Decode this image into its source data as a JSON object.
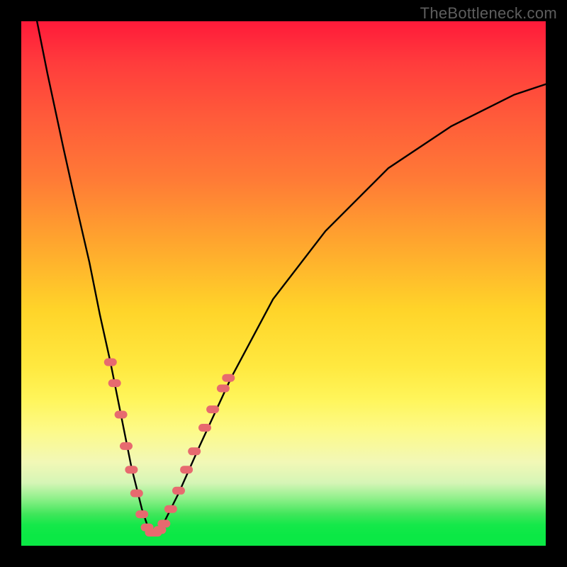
{
  "watermark": "TheBottleneck.com",
  "colors": {
    "background": "#000000",
    "curve": "#000000",
    "marker_fill": "#e76a6f",
    "marker_stroke": "#e76a6f"
  },
  "chart_data": {
    "type": "line",
    "title": "",
    "xlabel": "",
    "ylabel": "",
    "xlim": [
      0,
      100
    ],
    "ylim": [
      0,
      100
    ],
    "note": "Numeric axis values are estimated from pixel positions; no tick labels are visible in the source image.",
    "series": [
      {
        "name": "bottleneck-curve",
        "x": [
          3,
          5,
          8,
          10,
          13,
          15,
          17,
          19,
          21,
          23,
          24.5,
          26,
          27,
          30,
          34,
          40,
          48,
          58,
          70,
          82,
          94,
          100
        ],
        "y": [
          100,
          90,
          76,
          67,
          54,
          44,
          35,
          25,
          15,
          7,
          2.5,
          2.5,
          4,
          10,
          19,
          32,
          47,
          60,
          72,
          80,
          86,
          88
        ]
      }
    ],
    "markers": [
      {
        "x": 17.0,
        "y": 35.0
      },
      {
        "x": 17.8,
        "y": 31.0
      },
      {
        "x": 19.0,
        "y": 25.0
      },
      {
        "x": 20.0,
        "y": 19.0
      },
      {
        "x": 21.0,
        "y": 14.5
      },
      {
        "x": 22.0,
        "y": 10.0
      },
      {
        "x": 23.0,
        "y": 6.0
      },
      {
        "x": 24.0,
        "y": 3.5
      },
      {
        "x": 24.8,
        "y": 2.5
      },
      {
        "x": 25.6,
        "y": 2.5
      },
      {
        "x": 26.4,
        "y": 3.0
      },
      {
        "x": 27.2,
        "y": 4.2
      },
      {
        "x": 28.5,
        "y": 7.0
      },
      {
        "x": 30.0,
        "y": 10.5
      },
      {
        "x": 31.5,
        "y": 14.5
      },
      {
        "x": 33.0,
        "y": 18.0
      },
      {
        "x": 35.0,
        "y": 22.5
      },
      {
        "x": 36.5,
        "y": 26.0
      },
      {
        "x": 38.5,
        "y": 30.0
      },
      {
        "x": 39.5,
        "y": 32.0
      }
    ]
  }
}
